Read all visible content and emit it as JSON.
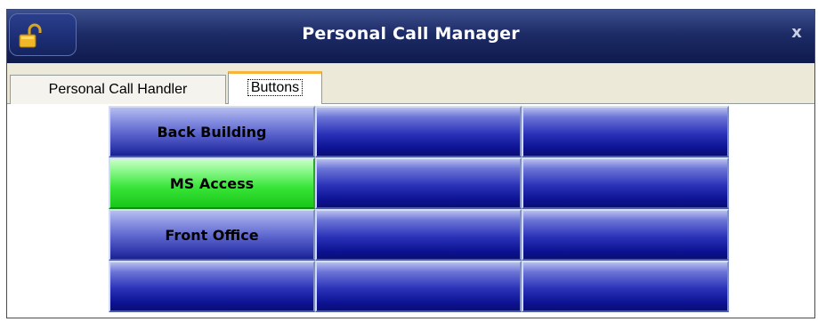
{
  "window": {
    "title": "Personal Call Manager",
    "close_label": "x"
  },
  "tabs": [
    {
      "label": "Personal Call Handler",
      "active": false
    },
    {
      "label": "Buttons",
      "active": true
    }
  ],
  "buttons": [
    [
      "Back Building",
      "",
      ""
    ],
    [
      "MS Access",
      "",
      ""
    ],
    [
      "Front Office",
      "",
      ""
    ],
    [
      "",
      "",
      ""
    ]
  ],
  "colors": {
    "button_blue": "#1a239a",
    "button_active_green": "#33e233",
    "tab_active_accent": "#f7b43a",
    "title_bar": "#1d2b66"
  },
  "icons": {
    "lock_button": "unlocked-padlock-icon",
    "close": "close-icon"
  }
}
